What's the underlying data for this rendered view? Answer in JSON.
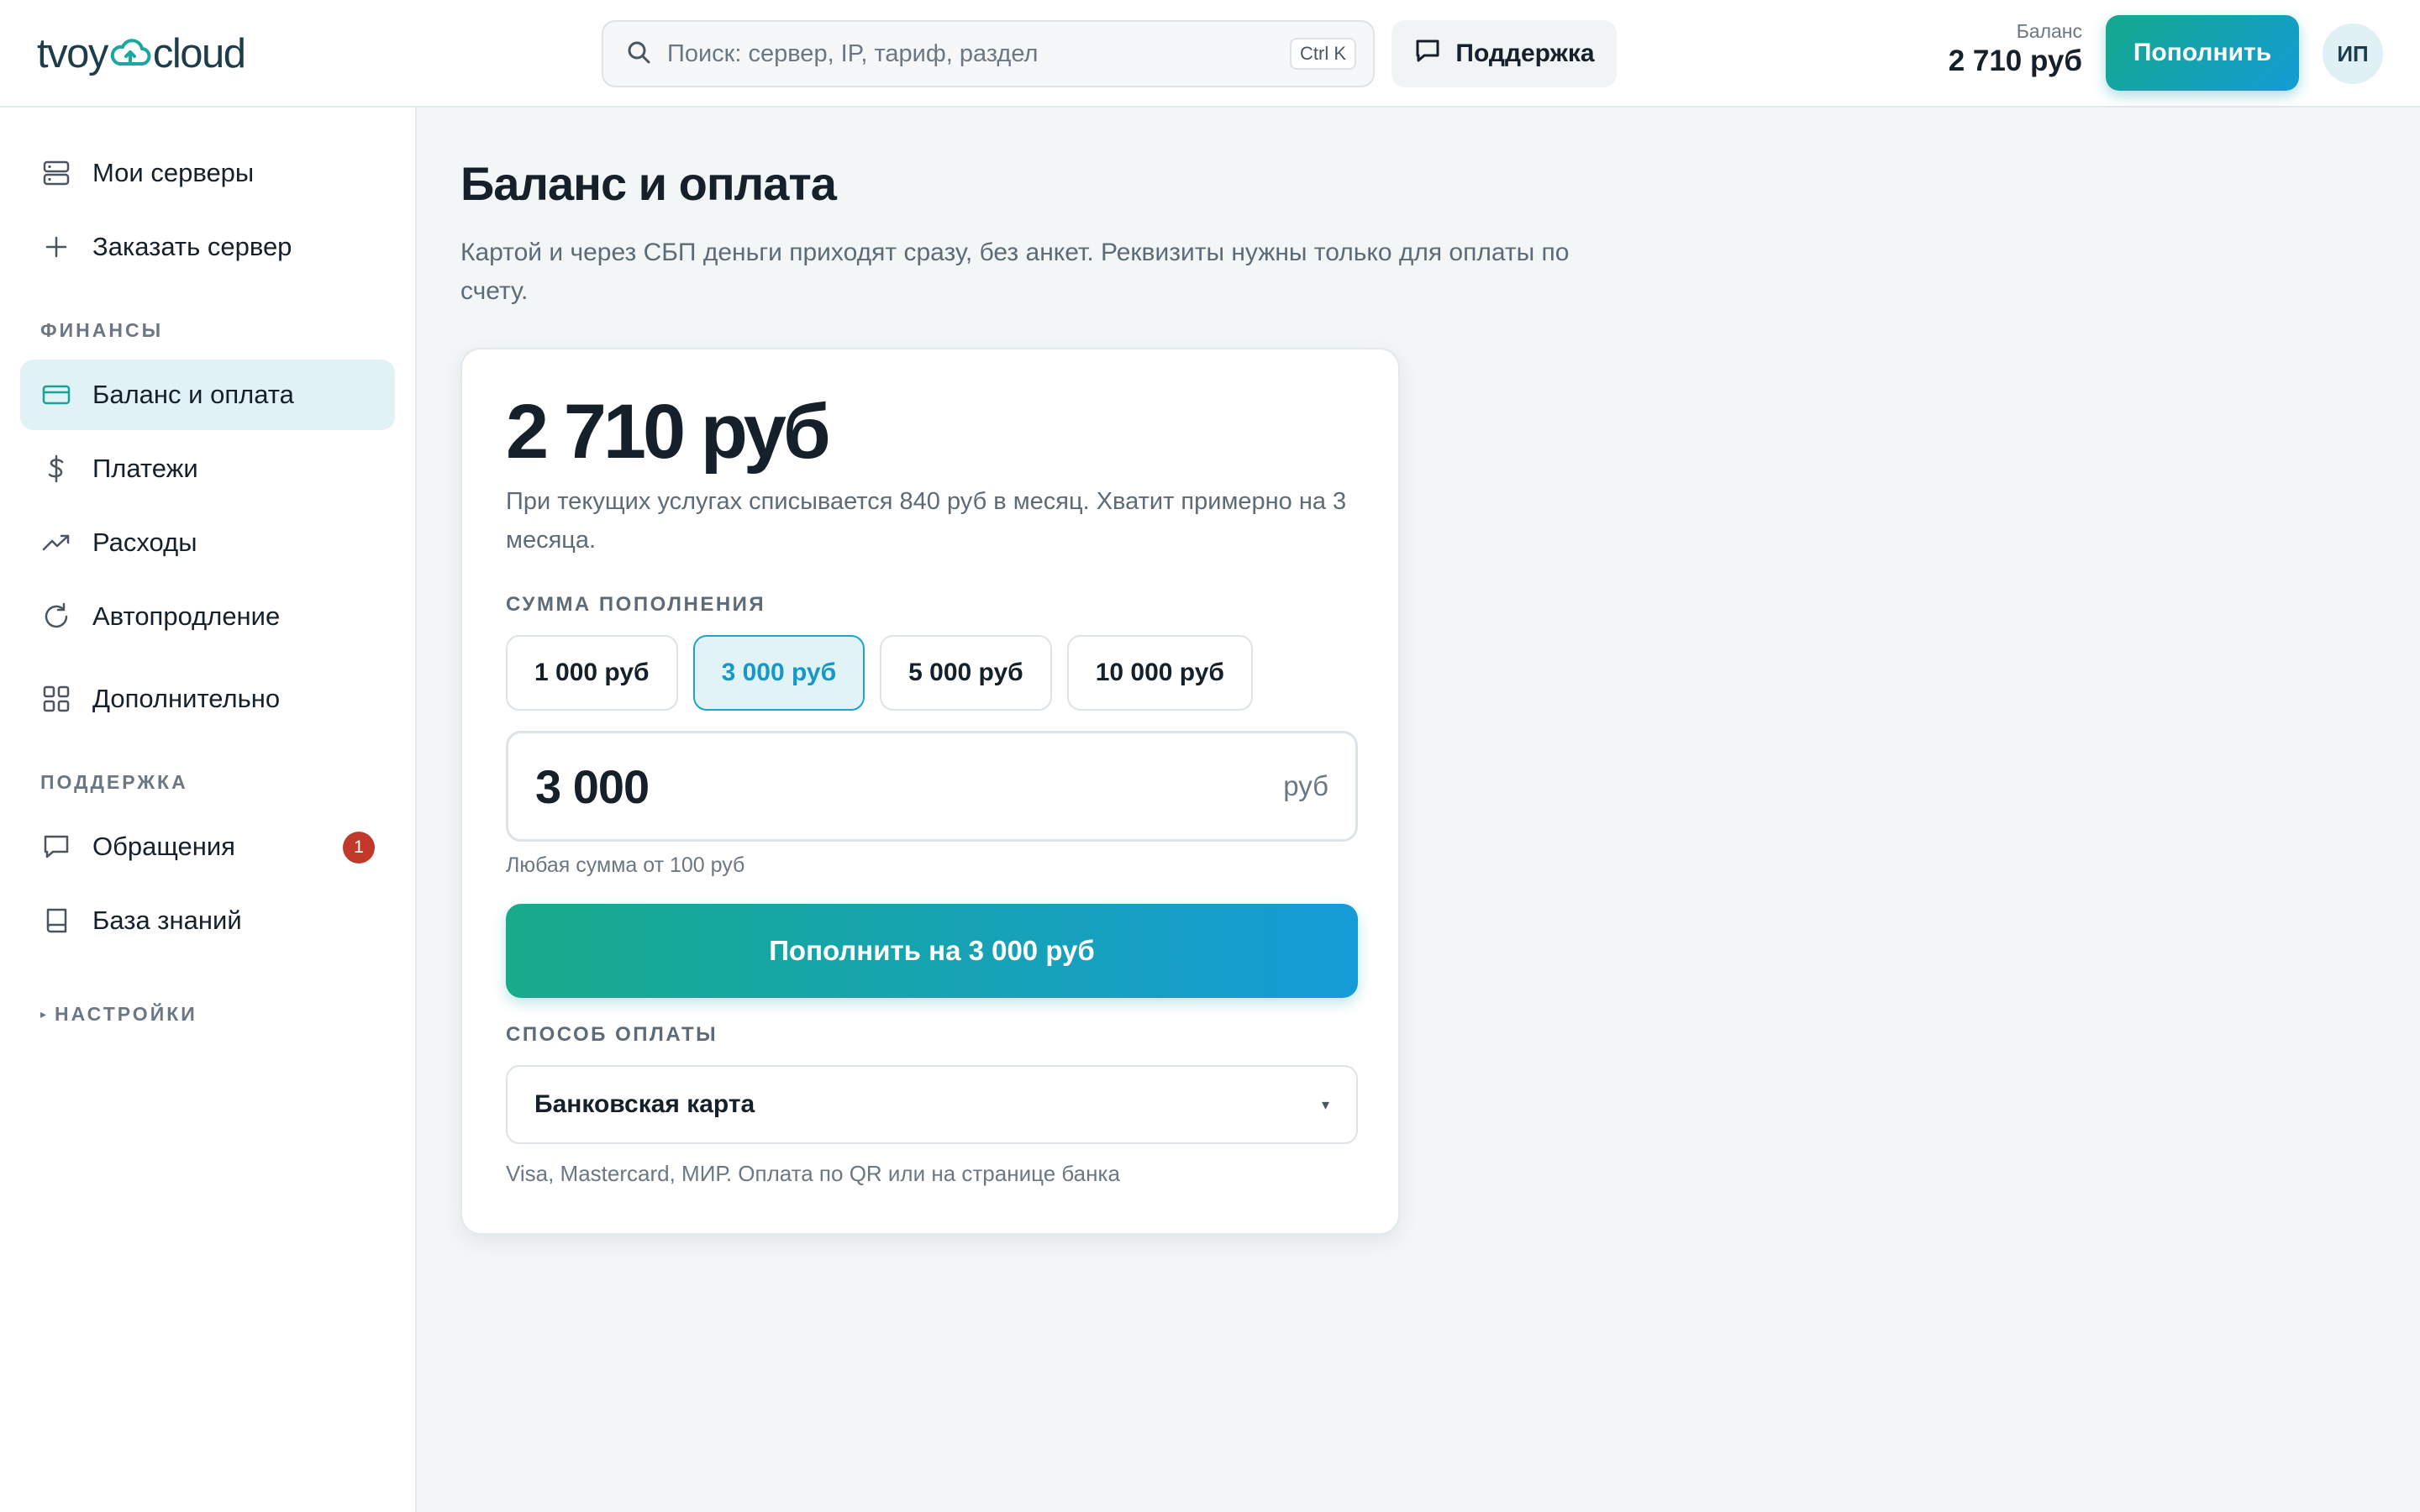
{
  "header": {
    "logo_left": "tvoy",
    "logo_right": "cloud",
    "search_placeholder": "Поиск: сервер, IP, тариф, раздел",
    "search_shortcut": "Ctrl K",
    "support_label": "Поддержка",
    "balance_label": "Баланс",
    "balance_value": "2 710 руб",
    "topup_label": "Пополнить",
    "avatar_initials": "ИП"
  },
  "sidebar": {
    "items_top": [
      {
        "label": "Мои серверы",
        "icon": "server-icon"
      },
      {
        "label": "Заказать сервер",
        "icon": "plus-icon"
      }
    ],
    "finance_label": "ФИНАНСЫ",
    "finance_items": [
      {
        "label": "Баланс и оплата",
        "icon": "card-icon",
        "active": true
      },
      {
        "label": "Платежи",
        "icon": "dollar-icon"
      },
      {
        "label": "Расходы",
        "icon": "trend-icon"
      },
      {
        "label": "Автопродление",
        "icon": "refresh-icon"
      },
      {
        "label": "Дополнительно",
        "icon": "grid-icon"
      }
    ],
    "support_label": "ПОДДЕРЖКА",
    "support_items": [
      {
        "label": "Обращения",
        "icon": "chat-icon",
        "badge": "1"
      },
      {
        "label": "База знаний",
        "icon": "book-icon"
      }
    ],
    "settings_label": "НАСТРОЙКИ"
  },
  "main": {
    "title": "Баланс и оплата",
    "subtitle": "Картой и через СБП деньги приходят сразу, без анкет. Реквизиты нужны только для оплаты по счету.",
    "balance": "2 710 руб",
    "note": "При текущих услугах списывается 840 руб в месяц. Хватит примерно на 3 месяца.",
    "amount_label": "СУММА ПОПОЛНЕНИЯ",
    "chips": [
      "1 000 руб",
      "3 000 руб",
      "5 000 руб",
      "10 000 руб"
    ],
    "selected_chip": "3 000 руб",
    "amount_value": "3 000",
    "amount_unit": "руб",
    "amount_hint": "Любая сумма от 100 руб",
    "pay_button": "Пополнить на 3 000 руб",
    "method_label": "СПОСОБ ОПЛАТЫ",
    "method_value": "Банковская карта",
    "method_hint": "Visa, Mastercard, МИР. Оплата по QR или на странице банка"
  },
  "colors": {
    "accent_start": "#14a98c",
    "accent_end": "#159bd5",
    "active_nav_bg": "#e1f2f6",
    "badge": "#c0392b"
  }
}
